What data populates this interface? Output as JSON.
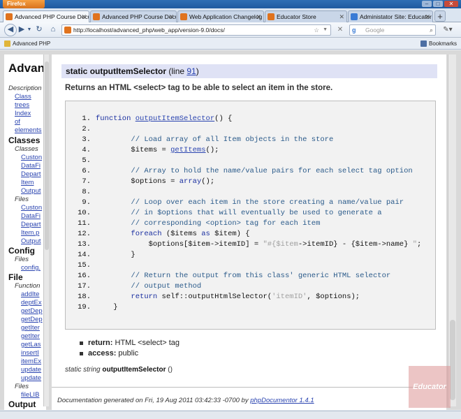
{
  "browser": {
    "app_button": "Firefox",
    "tabs": [
      {
        "label": "Advanced PHP Course Docu...",
        "active": true
      },
      {
        "label": "Advanced PHP Course Docu...",
        "active": false
      },
      {
        "label": "Web Application Changelog",
        "active": false
      },
      {
        "label": "Educator Store",
        "active": false
      },
      {
        "label": "Administator Site: Educator ...",
        "active": false
      }
    ],
    "url": "http://localhost/advanced_php/web_app/version-9.0/docs/",
    "search_placeholder": "Google",
    "bookmark": "Advanced PHP",
    "bookmarks_menu": "Bookmarks"
  },
  "sidebar": {
    "title": "Advan",
    "description_heading": "Description",
    "description_links": [
      "Class",
      "trees",
      "Index",
      "of",
      "elements"
    ],
    "classes_heading": "Classes",
    "classes_sub": "Classes",
    "classes_items": [
      "Custon",
      "DataFi",
      "Depart",
      "Item",
      "Output"
    ],
    "files_sub": "Files",
    "files_items": [
      "Custon",
      "DataFi",
      "Depart",
      "Item.p",
      "Output"
    ],
    "config_heading": "Config",
    "config_files_sub": "Files",
    "config_items": [
      "config."
    ],
    "file_heading": "File",
    "function_sub": "Function",
    "function_items": [
      "addIte",
      "deptEx",
      "getDep",
      "getDep",
      "getIter",
      "getIter",
      "getLas",
      "insertI",
      "itemEx",
      "update",
      "update"
    ],
    "file_files_sub": "Files",
    "file_items": [
      "fileLIB"
    ],
    "output_heading": "Output"
  },
  "method": {
    "prefix": "static ",
    "name": "outputItemSelector",
    "line_open": " (line ",
    "line_num": "91",
    "line_close": ")",
    "description": "Returns an HTML <select> tag to be able to select an item in the store.",
    "code_lines": [
      {
        "n": "1.",
        "html": "<span class=\"kw\">function</span> <span class=\"fn\">outputItemSelector</span>() {"
      },
      {
        "n": "2.",
        "html": ""
      },
      {
        "n": "3.",
        "html": "        <span class=\"cm\">// Load array of all Item objects in the store</span>"
      },
      {
        "n": "4.",
        "html": "        $items = <span class=\"fn\">getItems</span>();"
      },
      {
        "n": "5.",
        "html": ""
      },
      {
        "n": "6.",
        "html": "        <span class=\"cm\">// Array to hold the name/value pairs for each select tag option</span>"
      },
      {
        "n": "7.",
        "html": "        $options = <span class=\"kw\">array</span>();"
      },
      {
        "n": "8.",
        "html": ""
      },
      {
        "n": "9.",
        "html": "        <span class=\"cm\">// Loop over each item in the store creating a name/value pair</span>"
      },
      {
        "n": "10.",
        "html": "        <span class=\"cm\">// in $options that will eventually be used to generate a</span>"
      },
      {
        "n": "11.",
        "html": "        <span class=\"cm\">// corresponding &lt;option&gt; tag for each item</span>"
      },
      {
        "n": "12.",
        "html": "        <span class=\"kw\">foreach</span> ($items <span class=\"kw\">as</span> $item) {"
      },
      {
        "n": "13.",
        "html": "            $options[$item-&gt;itemID] = <span class=\"str\">\"#{$item</span>-&gt;itemID} - {$item-&gt;name} <span class=\"str\">\"</span>;"
      },
      {
        "n": "14.",
        "html": "        }"
      },
      {
        "n": "15.",
        "html": ""
      },
      {
        "n": "16.",
        "html": "        <span class=\"cm\">// Return the output from this class' generic HTML selector</span>"
      },
      {
        "n": "17.",
        "html": "        <span class=\"cm\">// output method</span>"
      },
      {
        "n": "18.",
        "html": "        <span class=\"kw\">return</span> self::outputHtmlSelector(<span class=\"str\">'itemID'</span>, $options);"
      },
      {
        "n": "19.",
        "html": "    }"
      }
    ],
    "return_label": "return:",
    "return_value": " HTML <select> tag",
    "access_label": "access:",
    "access_value": " public",
    "static_sig_prefix": "static string ",
    "static_sig_name": "outputItemSelector",
    "static_sig_suffix": " ()"
  },
  "footer": {
    "text": "Documentation generated on Fri, 19 Aug 2011 03:42:33 -0700 by ",
    "link": "phpDocumentor 1.4.1"
  },
  "watermark": "Educator"
}
